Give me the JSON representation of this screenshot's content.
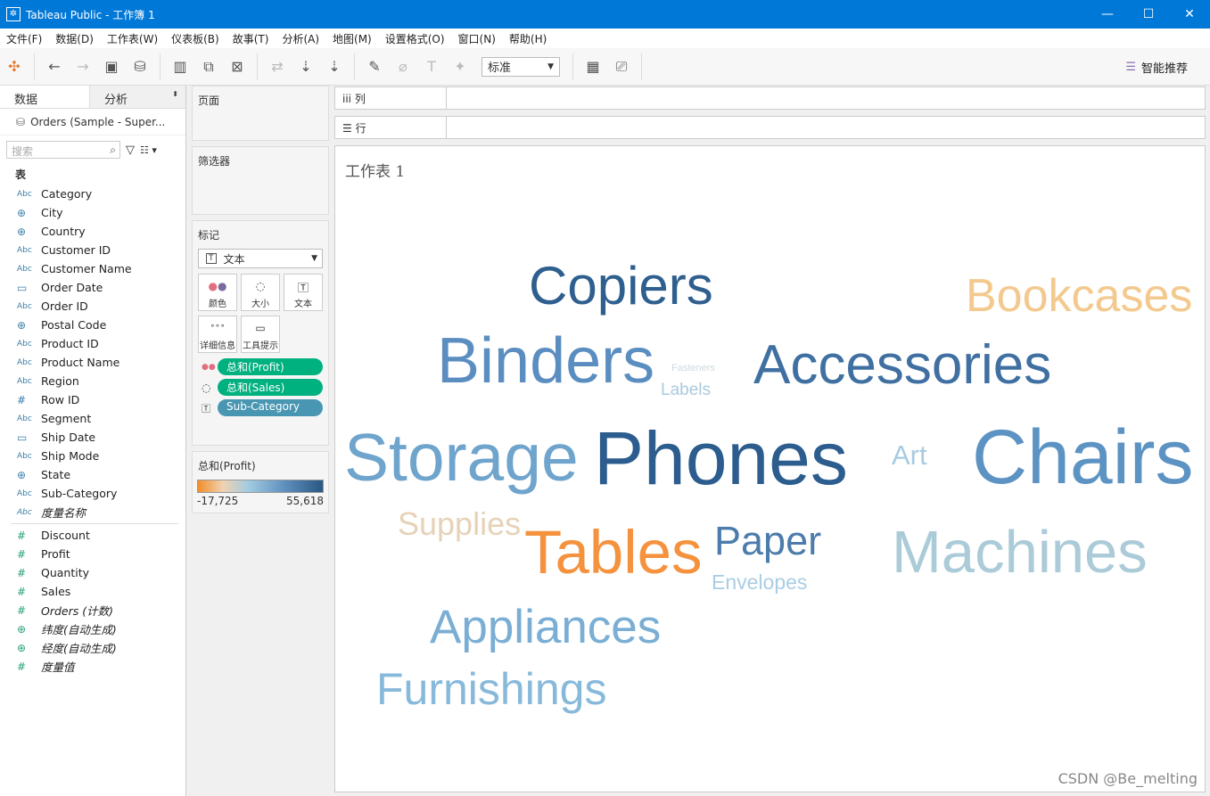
{
  "window": {
    "title": "Tableau Public - 工作簿 1",
    "minimize": "—",
    "maximize": "☐",
    "close": "✕"
  },
  "menu": [
    "文件(F)",
    "数据(D)",
    "工作表(W)",
    "仪表板(B)",
    "故事(T)",
    "分析(A)",
    "地图(M)",
    "设置格式(O)",
    "窗口(N)",
    "帮助(H)"
  ],
  "toolbar": {
    "fit_select": "标准",
    "smart_recommend": "智能推荐"
  },
  "left": {
    "tab_data": "数据",
    "tab_analysis": "分析",
    "datasource": "Orders (Sample - Super...",
    "search_placeholder": "搜索",
    "section_tables": "表",
    "dimensions": [
      {
        "icon": "Abc",
        "name": "Category"
      },
      {
        "icon": "globe",
        "name": "City"
      },
      {
        "icon": "globe",
        "name": "Country"
      },
      {
        "icon": "Abc",
        "name": "Customer ID"
      },
      {
        "icon": "Abc",
        "name": "Customer Name"
      },
      {
        "icon": "date",
        "name": "Order Date"
      },
      {
        "icon": "Abc",
        "name": "Order ID"
      },
      {
        "icon": "globe",
        "name": "Postal Code"
      },
      {
        "icon": "Abc",
        "name": "Product ID"
      },
      {
        "icon": "Abc",
        "name": "Product Name"
      },
      {
        "icon": "Abc",
        "name": "Region"
      },
      {
        "icon": "#",
        "name": "Row ID"
      },
      {
        "icon": "Abc",
        "name": "Segment"
      },
      {
        "icon": "date",
        "name": "Ship Date"
      },
      {
        "icon": "Abc",
        "name": "Ship Mode"
      },
      {
        "icon": "globe",
        "name": "State"
      },
      {
        "icon": "Abc",
        "name": "Sub-Category"
      },
      {
        "icon": "Abc",
        "name": "度量名称",
        "italic": true
      }
    ],
    "measures": [
      {
        "icon": "#",
        "name": "Discount"
      },
      {
        "icon": "#",
        "name": "Profit"
      },
      {
        "icon": "#",
        "name": "Quantity"
      },
      {
        "icon": "#",
        "name": "Sales"
      },
      {
        "icon": "#",
        "name": "Orders (计数)",
        "italic": true
      },
      {
        "icon": "globe",
        "name": "纬度(自动生成)",
        "italic": true
      },
      {
        "icon": "globe",
        "name": "经度(自动生成)",
        "italic": true
      },
      {
        "icon": "#",
        "name": "度量值",
        "italic": true
      }
    ]
  },
  "cards": {
    "pages": "页面",
    "filters": "筛选器",
    "marks": "标记",
    "mark_type": "文本",
    "mark_buttons": [
      "颜色",
      "大小",
      "文本",
      "详细信息",
      "工具提示"
    ],
    "pills": [
      {
        "label": "总和(Profit)",
        "color": "#00b180"
      },
      {
        "label": "总和(Sales)",
        "color": "#00b180"
      },
      {
        "label": "Sub-Category",
        "color": "#4996b2"
      }
    ],
    "legend": {
      "title": "总和(Profit)",
      "min": "-17,725",
      "max": "55,618",
      "colors": [
        "#f28e2b",
        "#f0d3b0",
        "#a3cbe2",
        "#2a5783"
      ]
    }
  },
  "shelves": {
    "columns": "列",
    "rows": "行"
  },
  "sheet_title": "工作表 1",
  "words": [
    {
      "text": "Copiers",
      "color": "#2e5f8e"
    },
    {
      "text": "Bookcases",
      "color": "#f3c98e"
    },
    {
      "text": "Binders",
      "color": "#5b8ec0"
    },
    {
      "text": "Fasteners",
      "color": "#cfd8e0"
    },
    {
      "text": "Labels",
      "color": "#a9cadf"
    },
    {
      "text": "Accessories",
      "color": "#3f70a1"
    },
    {
      "text": "Storage",
      "color": "#6fa4cd"
    },
    {
      "text": "Phones",
      "color": "#2c5d8e"
    },
    {
      "text": "Art",
      "color": "#a8cbe1"
    },
    {
      "text": "Chairs",
      "color": "#5c93c3"
    },
    {
      "text": "Supplies",
      "color": "#e6d2b7"
    },
    {
      "text": "Tables",
      "color": "#f5923e"
    },
    {
      "text": "Paper",
      "color": "#4c7cab"
    },
    {
      "text": "Machines",
      "color": "#abcbd8"
    },
    {
      "text": "Envelopes",
      "color": "#a9cde4"
    },
    {
      "text": "Appliances",
      "color": "#7aaed4"
    },
    {
      "text": "Furnishings",
      "color": "#87b9db"
    }
  ],
  "watermark": "CSDN @Be_melting"
}
